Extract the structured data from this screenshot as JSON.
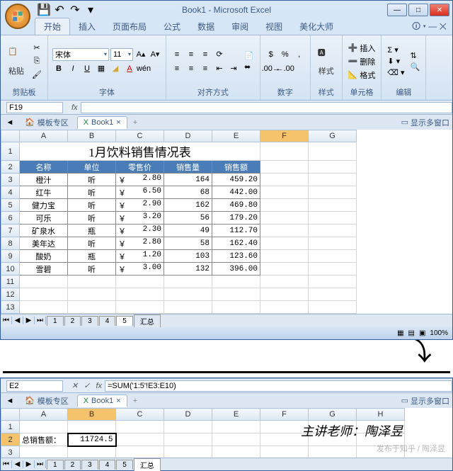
{
  "titlebar": {
    "title": "Book1 - Microsoft Excel"
  },
  "ribbon": {
    "tabs": [
      "开始",
      "插入",
      "页面布局",
      "公式",
      "数据",
      "审阅",
      "视图",
      "美化大师"
    ],
    "active": 0,
    "clipboard": {
      "paste": "粘贴",
      "label": "剪贴板"
    },
    "font": {
      "name": "宋体",
      "size": "11",
      "label": "字体"
    },
    "align": {
      "label": "对齐方式"
    },
    "number": {
      "label": "数字"
    },
    "styles": {
      "btn": "样式",
      "label": "样式"
    },
    "cells": {
      "insert": "插入",
      "delete": "删除",
      "format": "格式",
      "label": "单元格"
    },
    "editing": {
      "label": "编辑"
    }
  },
  "top": {
    "namebox": "F19",
    "formula": "",
    "doc_tabs": {
      "template": "模板专区",
      "book": "Book1",
      "multi": "显示多窗口"
    },
    "sheet_tabs": [
      "1",
      "2",
      "3",
      "4",
      "5",
      "汇总"
    ],
    "zoom": "100%"
  },
  "chart_data": {
    "type": "table",
    "title": "1月饮料销售情况表",
    "columns": [
      "名称",
      "单位",
      "零售价",
      "销售量",
      "销售额"
    ],
    "rows": [
      {
        "name": "橙汁",
        "unit": "听",
        "price": "2.80",
        "qty": "164",
        "amt": "459.20"
      },
      {
        "name": "红牛",
        "unit": "听",
        "price": "6.50",
        "qty": "68",
        "amt": "442.00"
      },
      {
        "name": "健力宝",
        "unit": "听",
        "price": "2.90",
        "qty": "162",
        "amt": "469.80"
      },
      {
        "name": "可乐",
        "unit": "听",
        "price": "3.20",
        "qty": "56",
        "amt": "179.20"
      },
      {
        "name": "矿泉水",
        "unit": "瓶",
        "price": "2.30",
        "qty": "49",
        "amt": "112.70"
      },
      {
        "name": "美年达",
        "unit": "听",
        "price": "2.80",
        "qty": "58",
        "amt": "162.40"
      },
      {
        "name": "酸奶",
        "unit": "瓶",
        "price": "1.20",
        "qty": "103",
        "amt": "123.60"
      },
      {
        "name": "雪碧",
        "unit": "听",
        "price": "3.00",
        "qty": "132",
        "amt": "396.00"
      }
    ]
  },
  "cols": [
    "A",
    "B",
    "C",
    "D",
    "E",
    "F",
    "G"
  ],
  "bottom": {
    "namebox": "E2",
    "formula": "=SUM('1:5'!E3:E10)",
    "total_label": "总销售额：",
    "total_value": "11724.5",
    "cols": [
      "A",
      "B",
      "C",
      "D",
      "E",
      "F",
      "G",
      "H"
    ],
    "teacher_label": "主讲老师：",
    "teacher_name": "陶泽昱",
    "watermark": "发布于知乎 / 陶泽昱"
  }
}
